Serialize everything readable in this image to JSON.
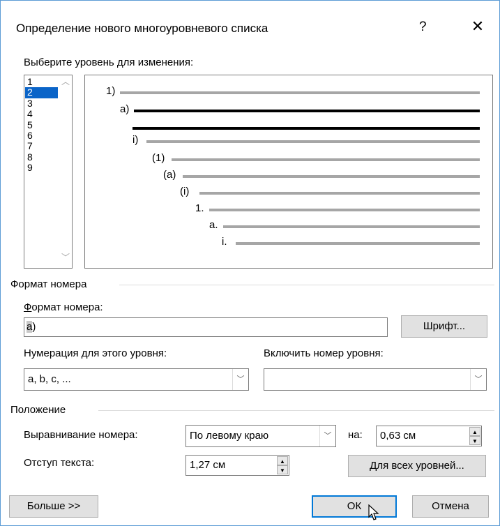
{
  "dialog": {
    "title": "Определение нового многоуровневого списка",
    "help_label": "?",
    "close_label": "✕"
  },
  "level_select": {
    "label": "Выберите уровень для изменения:",
    "levels": [
      "1",
      "2",
      "3",
      "4",
      "5",
      "6",
      "7",
      "8",
      "9"
    ],
    "selected": "2"
  },
  "preview": {
    "labels": [
      "1)",
      "a)",
      "i)",
      "(1)",
      "(a)",
      "(i)",
      "1.",
      "a.",
      "i."
    ]
  },
  "number_format_group": {
    "title": "Формат номера",
    "format_label": "Формат номера:",
    "format_value_selected": "a",
    "format_value_rest": ")",
    "font_button": "Шрифт...",
    "numbering_label": "Нумерация для этого уровня:",
    "numbering_value": "a, b, c, ...",
    "include_level_label": "Включить номер уровня:",
    "include_level_value": ""
  },
  "position_group": {
    "title": "Положение",
    "align_label": "Выравнивание номера:",
    "align_value": "По левому краю",
    "at_label": "на:",
    "at_value": "0,63 см",
    "indent_label": "Отступ текста:",
    "indent_value": "1,27 см",
    "all_levels_button": "Для всех уровней..."
  },
  "footer": {
    "more_button": "Больше >>",
    "ok_button": "ОК",
    "cancel_button": "Отмена"
  },
  "colors": {
    "accent": "#0078d7",
    "selection": "#0a64c8",
    "border": "#5b9bd5"
  }
}
